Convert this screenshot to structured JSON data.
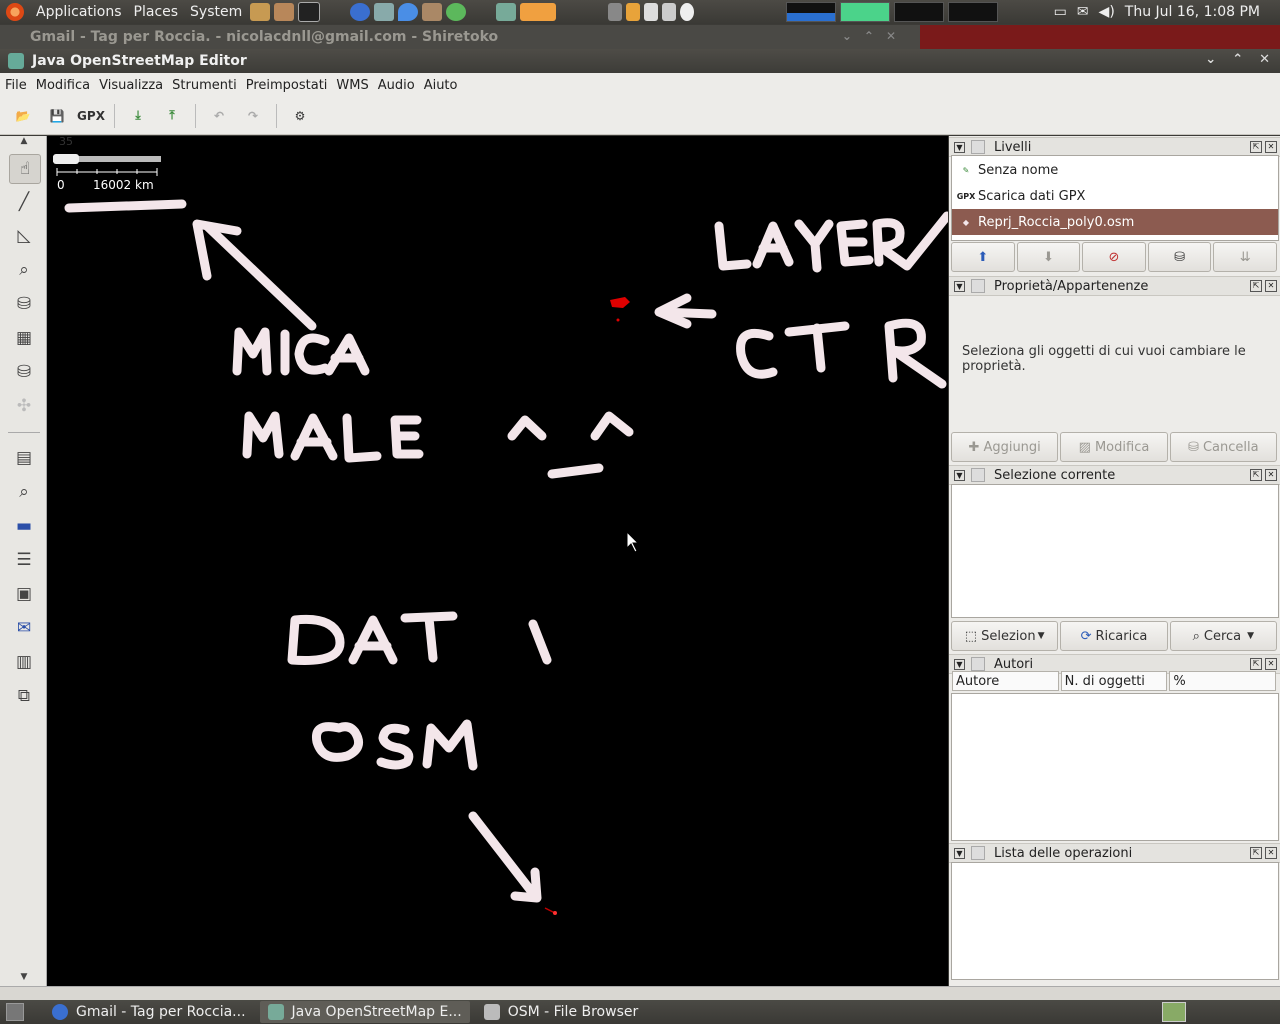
{
  "top_panel": {
    "menus": [
      "Applications",
      "Places",
      "System"
    ],
    "clock": "Thu Jul 16,  1:08 PM"
  },
  "background_window": {
    "title": "Gmail - Tag per Roccia. - nicolacdnll@gmail.com - Shiretoko"
  },
  "josm": {
    "title": "Java OpenStreetMap Editor",
    "menu": [
      {
        "label": "File"
      },
      {
        "label": "Modifica"
      },
      {
        "label": "Visualizza"
      },
      {
        "label": "Strumenti"
      },
      {
        "label": "Preimpostati"
      },
      {
        "label": "WMS"
      },
      {
        "label": "Audio"
      },
      {
        "label": "Aiuto"
      }
    ],
    "toolbar": {
      "gpx_label": "GPX"
    },
    "map": {
      "zoom_level": "35",
      "scale_start": "0",
      "scale_end": "16002 km",
      "annotations": [
        "MICA MALE ^_^",
        "LAYER CTR",
        "DATI OSM"
      ]
    },
    "layers": {
      "title": "Livelli",
      "items": [
        {
          "name": "Senza nome",
          "icon": "edit-layer-icon",
          "selected": false
        },
        {
          "name": "Scarica dati GPX",
          "icon": "gpx-layer-icon",
          "selected": false
        },
        {
          "name": "Reprj_Roccia_poly0.osm",
          "icon": "data-layer-icon",
          "selected": true
        }
      ]
    },
    "properties": {
      "title": "Proprietà/Appartenenze",
      "message": "Seleziona gli oggetti di cui vuoi cambiare le proprietà.",
      "buttons": {
        "add": "Aggiungi",
        "edit": "Modifica",
        "delete": "Cancella"
      }
    },
    "selection": {
      "title": "Selezione corrente",
      "buttons": {
        "select": "Selezion",
        "reload": "Ricarica",
        "search": "Cerca"
      }
    },
    "authors": {
      "title": "Autori",
      "columns": [
        "Autore",
        "N. di oggetti",
        "%"
      ]
    },
    "history": {
      "title": "Lista delle operazioni"
    }
  },
  "taskbar": {
    "tasks": [
      {
        "label": "Gmail - Tag per Roccia...",
        "active": false
      },
      {
        "label": "Java OpenStreetMap E...",
        "active": true
      },
      {
        "label": "OSM - File Browser",
        "active": false
      }
    ]
  },
  "colors": {
    "selected_layer": "#8c5b50",
    "map_background": "#000000",
    "handwriting": "#f3e6ea",
    "osm_data": "#e00000"
  }
}
